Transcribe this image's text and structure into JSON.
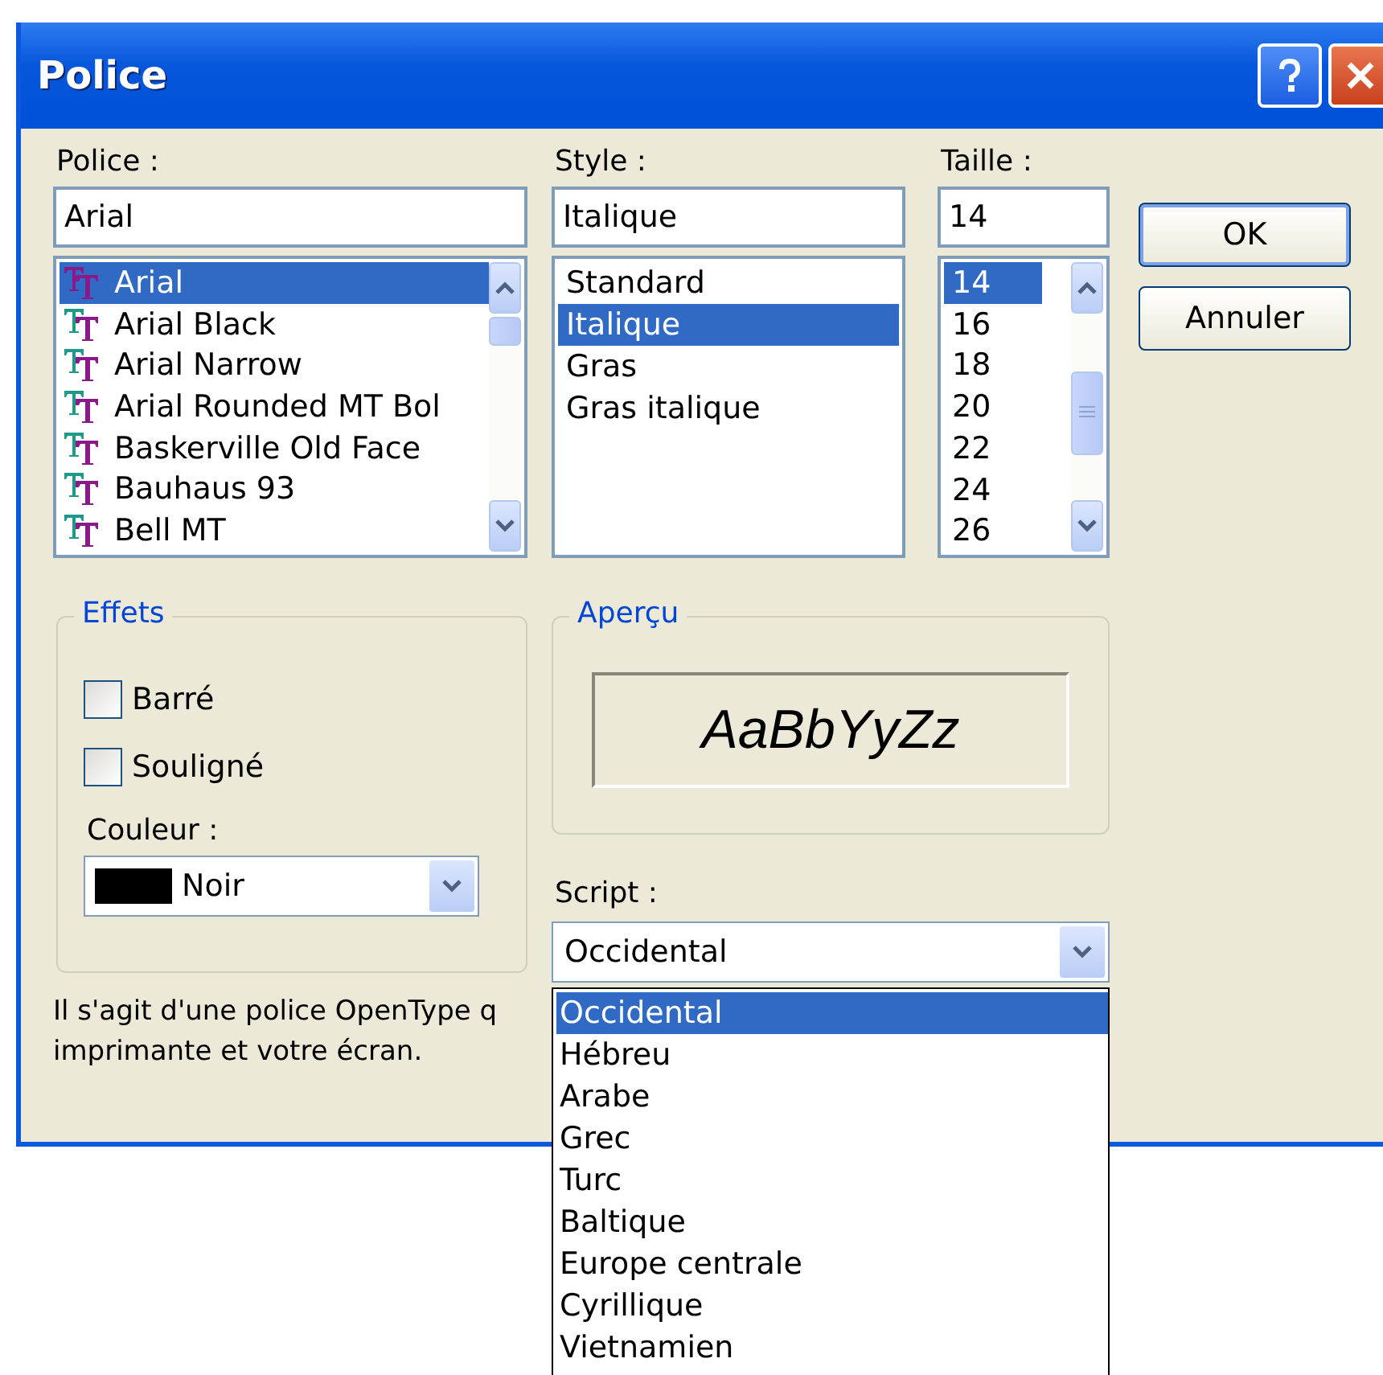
{
  "window": {
    "title": "Police"
  },
  "font": {
    "label": "Police :",
    "value": "Arial",
    "items": [
      {
        "name": "Arial",
        "selected": true
      },
      {
        "name": "Arial Black",
        "selected": false
      },
      {
        "name": "Arial Narrow",
        "selected": false
      },
      {
        "name": "Arial Rounded MT Bol",
        "selected": false
      },
      {
        "name": "Baskerville Old Face",
        "selected": false
      },
      {
        "name": "Bauhaus 93",
        "selected": false
      },
      {
        "name": "Bell MT",
        "selected": false
      }
    ]
  },
  "style": {
    "label": "Style :",
    "value": "Italique",
    "items": [
      {
        "name": "Standard",
        "selected": false
      },
      {
        "name": "Italique",
        "selected": true
      },
      {
        "name": "Gras",
        "selected": false
      },
      {
        "name": "Gras italique",
        "selected": false
      }
    ]
  },
  "size": {
    "label": "Taille :",
    "value": "14",
    "items": [
      {
        "name": "14",
        "selected": true
      },
      {
        "name": "16",
        "selected": false
      },
      {
        "name": "18",
        "selected": false
      },
      {
        "name": "20",
        "selected": false
      },
      {
        "name": "22",
        "selected": false
      },
      {
        "name": "24",
        "selected": false
      },
      {
        "name": "26",
        "selected": false
      }
    ]
  },
  "buttons": [
    {
      "label": "OK",
      "default": true
    },
    {
      "label": "Annuler",
      "default": false
    }
  ],
  "effects": {
    "title": "Effets",
    "checkboxes": [
      {
        "label": "Barré",
        "checked": false
      },
      {
        "label": "Souligné",
        "checked": false
      }
    ],
    "color_label": "Couleur :",
    "color": {
      "value": "Noir",
      "color": "#000000"
    }
  },
  "preview": {
    "title": "Aperçu",
    "sample": "AaBbYyZz"
  },
  "script": {
    "label": "Script :",
    "value": "Occidental",
    "options": [
      {
        "label": "Occidental",
        "selected": true
      },
      {
        "label": "Hébreu",
        "selected": false
      },
      {
        "label": "Arabe",
        "selected": false
      },
      {
        "label": "Grec",
        "selected": false
      },
      {
        "label": "Turc",
        "selected": false
      },
      {
        "label": "Baltique",
        "selected": false
      },
      {
        "label": "Europe centrale",
        "selected": false
      },
      {
        "label": "Cyrillique",
        "selected": false
      },
      {
        "label": "Vietnamien",
        "selected": false
      }
    ]
  },
  "description": [
    "Il s'agit d'une police OpenType q",
    "imprimante et votre écran."
  ]
}
